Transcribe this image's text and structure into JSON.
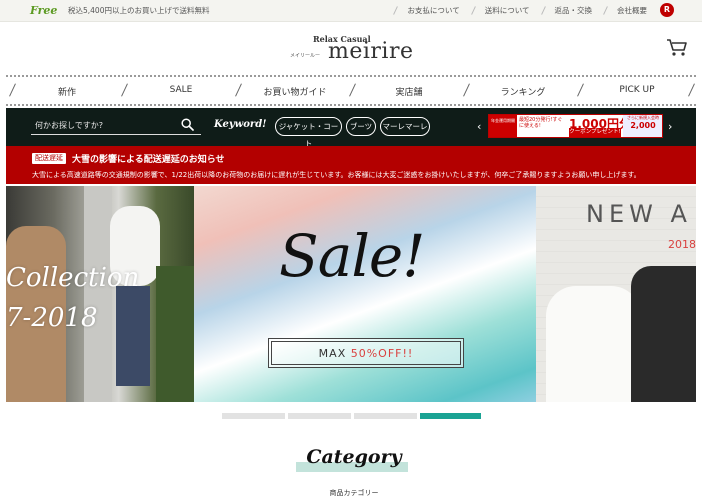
{
  "topbar": {
    "free_badge": "Free",
    "shipping_note": "税込5,400円以上のお買い上げで送料無料",
    "links": [
      "お支払について",
      "送料について",
      "返品・交換",
      "会社概要"
    ],
    "rakuten_icon_letter": "R"
  },
  "logo": {
    "sub": "Relax Casual",
    "kana": "メイリールー",
    "main": "meirire"
  },
  "icons": {
    "cart": "cart-icon",
    "search": "search-icon",
    "rakuten": "rakuten-icon"
  },
  "nav": {
    "items": [
      "新作",
      "SALE",
      "お買い物ガイド",
      "実店舗",
      "ランキング",
      "PICK UP"
    ]
  },
  "search": {
    "placeholder": "何かお探しですか?",
    "keyword_label": "Keyword!",
    "chips": [
      "ジャケット・コート",
      "ブーツ",
      "マーレマーレ"
    ],
    "prev_arrow": "‹",
    "next_arrow": "›"
  },
  "promo": {
    "left_text": "年金運用期開",
    "mid_text": "最短20分発行!すぐに使える!",
    "amount": "1,000円分",
    "coupon": "クーポンプレゼント!",
    "right_top": "さらに新規入会時",
    "right_amount": "2,000"
  },
  "alert": {
    "badge": "配送遅延",
    "title": "大雪の影響による配送遅延のお知らせ",
    "body": "大雪による高速道路等の交通規制の影響で、1/22出荷以降のお荷物のお届けに遅れが生じています。お客様には大変ご迷惑をお掛けいたしますが、何卒ご了承賜りますようお願い申し上げます。"
  },
  "hero": {
    "left_text_line1": "Collection",
    "left_text_line2": "7-2018",
    "sale_text": "Sale!",
    "sale_box_prefix": "MAX ",
    "sale_box_accent": "50%OFF!!",
    "right_text": "NEW A",
    "right_year": "2018"
  },
  "carousel": {
    "dot_count": 4,
    "active_index": 3
  },
  "category": {
    "title": "Category",
    "subtitle": "商品カテゴリー"
  },
  "colors": {
    "accent_teal": "#1aa394",
    "alert_red": "#b30000",
    "search_bg": "#0f1c18",
    "sale_accent": "#d9413f",
    "free_green": "#5c9a22"
  }
}
